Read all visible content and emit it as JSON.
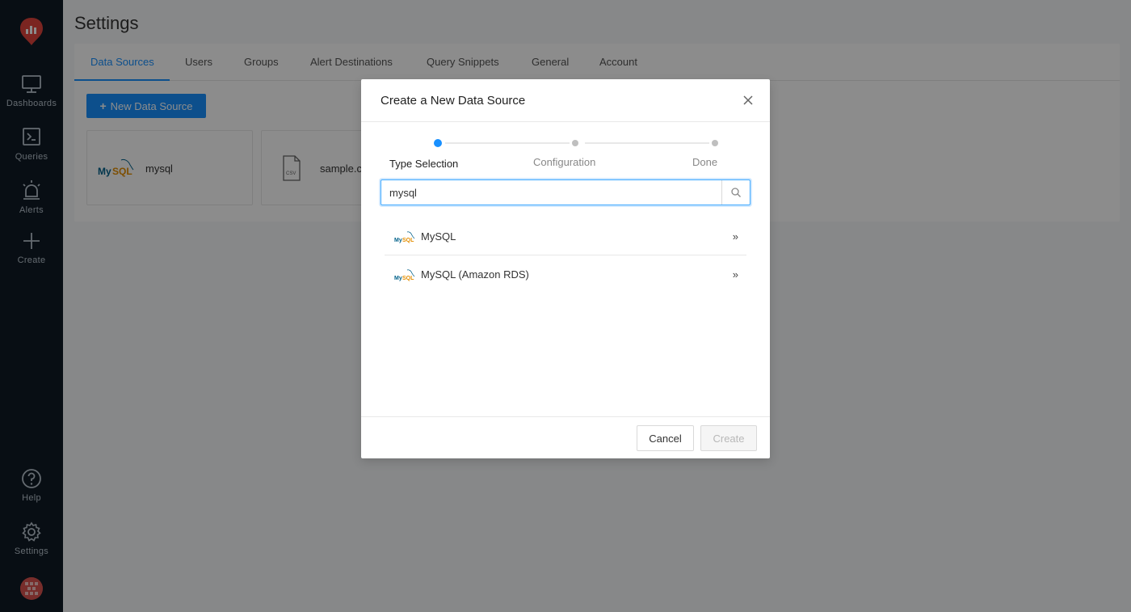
{
  "sidebar": {
    "items": [
      {
        "label": "Dashboards",
        "icon": "monitor-icon"
      },
      {
        "label": "Queries",
        "icon": "terminal-icon"
      },
      {
        "label": "Alerts",
        "icon": "alarm-icon"
      },
      {
        "label": "Create",
        "icon": "plus-icon"
      }
    ],
    "bottom_items": [
      {
        "label": "Help",
        "icon": "help-icon"
      },
      {
        "label": "Settings",
        "icon": "gear-icon"
      }
    ]
  },
  "page": {
    "title": "Settings",
    "tabs": [
      "Data Sources",
      "Users",
      "Groups",
      "Alert Destinations",
      "Query Snippets",
      "General",
      "Account"
    ],
    "active_tab": "Data Sources",
    "new_button_label": "New Data Source",
    "data_sources": [
      {
        "name": "mysql"
      },
      {
        "name": "sample.c"
      }
    ]
  },
  "modal": {
    "title": "Create a New Data Source",
    "steps": [
      "Type Selection",
      "Configuration",
      "Done"
    ],
    "active_step": 0,
    "search": {
      "value": "mysql"
    },
    "results": [
      {
        "label": "MySQL"
      },
      {
        "label": "MySQL (Amazon RDS)"
      }
    ],
    "cancel_label": "Cancel",
    "create_label": "Create"
  },
  "colors": {
    "sidebar_bg": "#0f1b26",
    "accent": "#1890ff",
    "logo_red": "#e0443d"
  }
}
